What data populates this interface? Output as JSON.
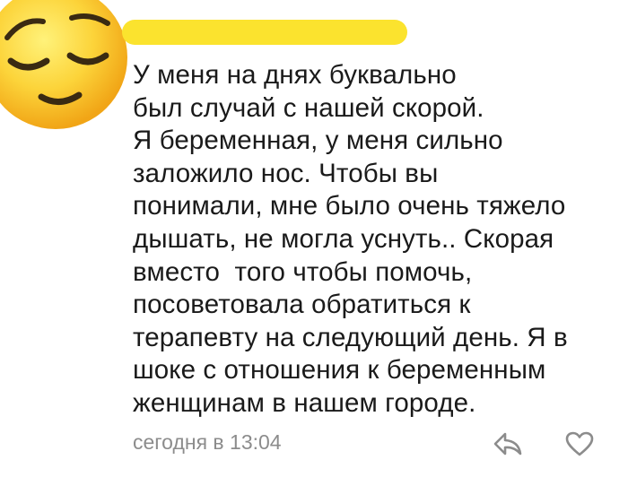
{
  "comment": {
    "author_redacted": true,
    "avatar_icon": "relieved-face-emoji-icon",
    "text_lines": [
      "У меня на днях буквально",
      "был случай с нашей скорой.",
      "Я беременная, у меня сильно",
      "заложило нос. Чтобы вы",
      "понимали, мне было очень тяжело",
      "дышать, не могла уснуть.. Скорая",
      "вместо  того чтобы помочь,",
      "посоветовала обратиться к",
      "терапевту на следующий день. Я в",
      "шоке с отношения к беременным",
      "женщинам в нашем городе."
    ],
    "timestamp": "сегодня в 13:04",
    "actions": {
      "reply_icon": "reply-arrow-icon",
      "like_icon": "heart-outline-icon"
    }
  },
  "colors": {
    "redaction": "#fbe32e",
    "text": "#1a1a1a",
    "meta": "#8c8c8c"
  }
}
